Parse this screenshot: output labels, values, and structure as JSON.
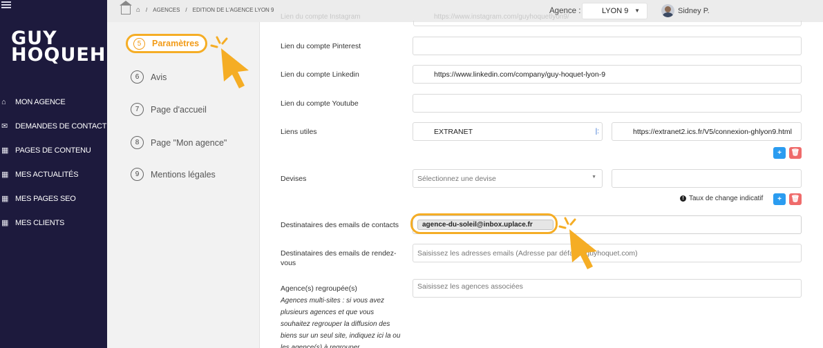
{
  "sidebar": {
    "logo_line1": "GUY",
    "logo_line2": "HOQUEH",
    "items": [
      {
        "icon": "home-icon",
        "glyph": "⌂",
        "label": "MON AGENCE"
      },
      {
        "icon": "mail-icon",
        "glyph": "✉",
        "label": "DEMANDES DE CONTACT"
      },
      {
        "icon": "grid-icon",
        "glyph": "▦",
        "label": "PAGES DE CONTENU"
      },
      {
        "icon": "grid-icon",
        "glyph": "▦",
        "label": "MES ACTUALITÉS"
      },
      {
        "icon": "grid-icon",
        "glyph": "▦",
        "label": "MES PAGES SEO"
      },
      {
        "icon": "grid-icon",
        "glyph": "▦",
        "label": "MES CLIENTS"
      }
    ]
  },
  "topbar": {
    "breadcrumb": [
      "AGENCES",
      "EDITION DE L'AGENCE LYON 9"
    ],
    "agence_label": "Agence :",
    "agence_value": "LYON 9",
    "user_name": "Sidney P."
  },
  "steps": [
    {
      "num": "5",
      "label": "Paramètres",
      "active": true
    },
    {
      "num": "6",
      "label": "Avis"
    },
    {
      "num": "7",
      "label": "Page d'accueil"
    },
    {
      "num": "8",
      "label": "Page \"Mon agence\""
    },
    {
      "num": "9",
      "label": "Mentions légales"
    }
  ],
  "form": {
    "faded_label": "Lien du compte Instagram",
    "faded_value": "https://www.instagram.com/guyhoquetlyon9/",
    "pinterest_label": "Lien du compte Pinterest",
    "pinterest_value": "",
    "linkedin_label": "Lien du compte Linkedin",
    "linkedin_value": "https://www.linkedin.com/company/guy-hoquet-lyon-9",
    "youtube_label": "Lien du compte Youtube",
    "youtube_value": "",
    "liens_label": "Liens utiles",
    "lien_name": "EXTRANET",
    "lien_url": "https://extranet2.ics.fr/V5/connexion-ghlyon9.html",
    "devises_label": "Devises",
    "devises_placeholder": "Sélectionnez une devise",
    "rate_note": "Taux de change indicatif",
    "contacts_label": "Destinataires des emails de contacts",
    "contacts_email": "agence-du-soleil@inbox.uplace.fr",
    "rdv_label": "Destinataires des emails de rendez-vous",
    "rdv_placeholder": "Saisissez les adresses emails (Adresse par défaut :           guyhoquet.com)",
    "groupe_label": "Agence(s) regroupée(s)",
    "groupe_help": "Agences multi-sites : si vous avez plusieurs agences et que vous souhaitez regrouper la diffusion des biens sur un seul site, indiquez ici la ou les agence(s) à regrouper.",
    "groupe_placeholder": "Saisissez les agences associées",
    "add_glyph": "+",
    "delete_glyph": "🗑",
    "info_glyph": "!"
  },
  "colors": {
    "sidebar_bg": "#1d1a3d",
    "highlight": "#f5ad25",
    "accent_orange": "#f29b17",
    "button_blue": "#2b9cf0",
    "button_red": "#ef6b6b"
  }
}
